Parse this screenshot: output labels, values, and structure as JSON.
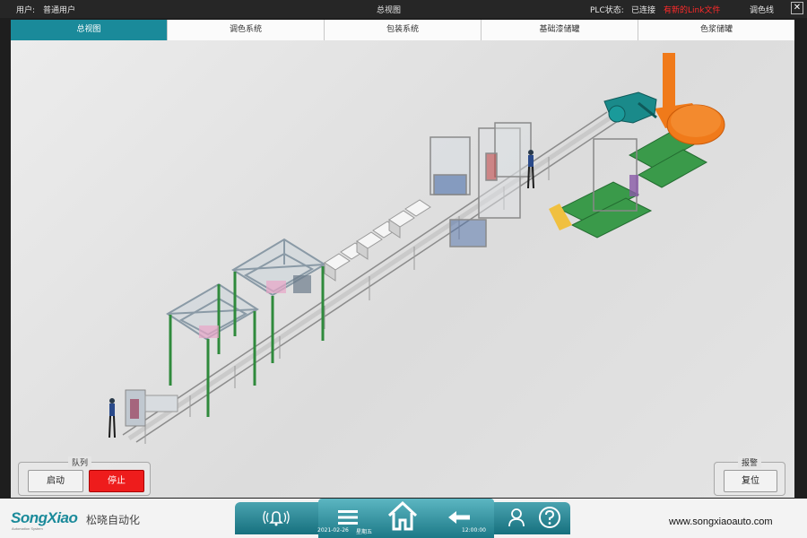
{
  "topbar": {
    "user_label": "用户:",
    "user_value": "普通用户",
    "title": "总视图",
    "plc_label": "PLC状态:",
    "plc_value": "已连接",
    "alert_text": "有新的Link文件",
    "line_name": "调色线",
    "close_glyph": "✕"
  },
  "tabs": [
    {
      "label": "总视图",
      "active": true
    },
    {
      "label": "调色系统",
      "active": false
    },
    {
      "label": "包装系统",
      "active": false
    },
    {
      "label": "基础漆储罐",
      "active": false
    },
    {
      "label": "色浆储罐",
      "active": false
    }
  ],
  "queue": {
    "legend": "队列",
    "start_label": "启动",
    "stop_label": "停止"
  },
  "alarm": {
    "legend": "报警",
    "reset_label": "复位"
  },
  "footer": {
    "brand_en": "SongXiao",
    "brand_cn": "松晓自动化",
    "brand_sub": "Automation System",
    "website": "www.songxiaoauto.com",
    "date": "2021-02-26",
    "weekday": "星期五",
    "time": "12:00:00"
  },
  "colors": {
    "accent": "#1a8a9a",
    "stop": "#ee1c1c",
    "alert": "#ff2a2a",
    "robot": "#f07a1a",
    "machine_green": "#2f8a3c"
  },
  "icons": [
    "alarm-bell-icon",
    "menu-icon",
    "home-icon",
    "back-arrow-icon",
    "user-icon",
    "help-icon"
  ]
}
